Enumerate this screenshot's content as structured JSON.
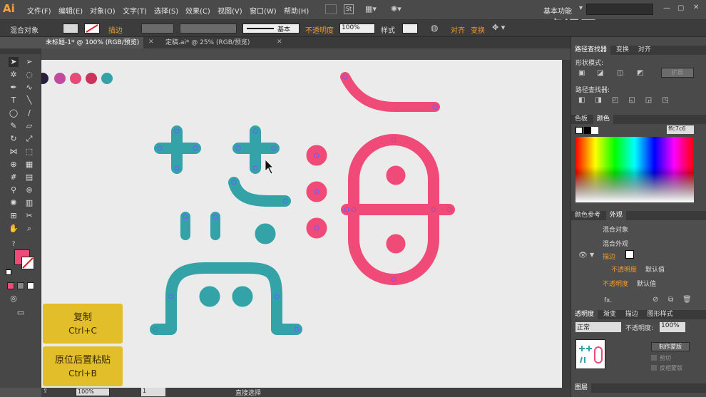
{
  "app": {
    "logo": "Ai",
    "workspace": "基本功能",
    "search_placeholder": ""
  },
  "menu": [
    "文件(F)",
    "编辑(E)",
    "对象(O)",
    "文字(T)",
    "选择(S)",
    "效果(C)",
    "视图(V)",
    "窗口(W)",
    "帮助(H)"
  ],
  "control": {
    "object_type": "混合对象",
    "stroke_label": "描边",
    "stroke_style": "基本",
    "opacity_label": "不透明度",
    "opacity_value": "100%",
    "style_label": "样式",
    "align_label": "对齐",
    "transform_label": "变换"
  },
  "doc_tabs": [
    "未标题-1* @ 100% (RGB/预览)",
    "定稿.ai* @ 25% (RGB/预览)"
  ],
  "swatch_colors": [
    "#2b1e3b",
    "#c04a9d",
    "#e84a77",
    "#c9335c",
    "#33a3a8"
  ],
  "colors": {
    "teal": "#33a3a8",
    "pink": "#ef4a78",
    "anchor": "#6b5cff"
  },
  "pathfinder": {
    "tabs": [
      "路径查找器",
      "变换",
      "对齐"
    ],
    "shape_modes": "形状模式:",
    "expand": "扩展",
    "pathfinders": "路径查找器:"
  },
  "color_panel": {
    "tabs": [
      "色板",
      "颜色"
    ],
    "hex": "ffc7c6"
  },
  "appearance": {
    "tabs": [
      "颜色参考",
      "外观"
    ],
    "rows": [
      "混合对象",
      "混合外观",
      "描边",
      "不透明度",
      "默认值",
      "不透明度",
      "默认值"
    ],
    "fx": "fx."
  },
  "transparency": {
    "tabs": [
      "透明度",
      "渐变",
      "描边",
      "图形样式"
    ],
    "mode": "正常",
    "opacity_label": "不透明度:",
    "opacity_value": "100%",
    "make_mask": "制作蒙版",
    "clip": "剪切",
    "invert": "反相蒙版"
  },
  "layers": {
    "tab": "图层"
  },
  "status": {
    "zoom": "100%",
    "page": "1",
    "tool": "直接选择"
  },
  "keys": [
    {
      "title": "复制",
      "shortcut": "Ctrl+C"
    },
    {
      "title": "原位后置粘贴",
      "shortcut": "Ctrl+B"
    }
  ],
  "watermark": "虎课网"
}
